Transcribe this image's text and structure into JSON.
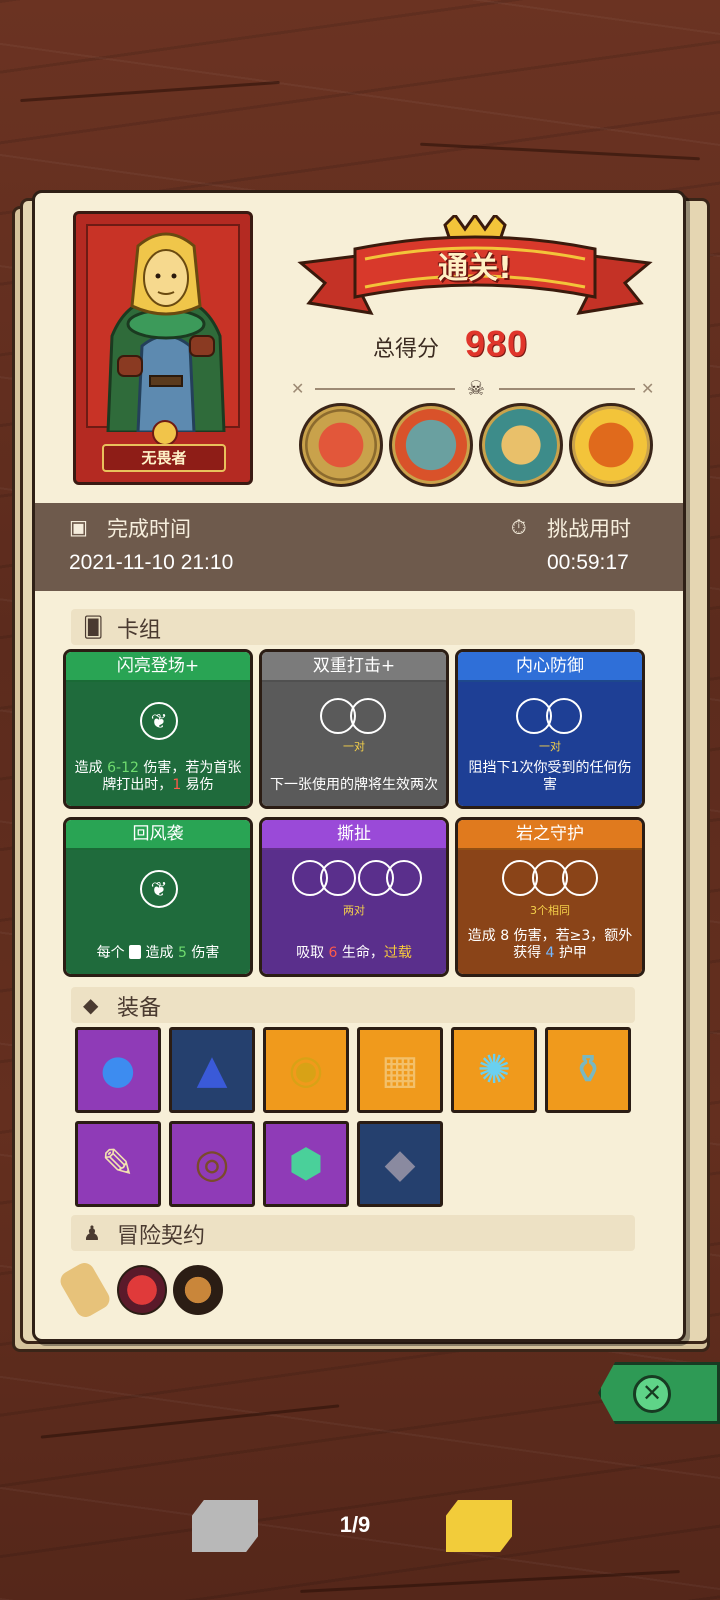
{
  "hero": {
    "name": "无畏者"
  },
  "result": {
    "title": "通关!",
    "score_label": "总得分",
    "score": "980"
  },
  "time": {
    "complete_label": "完成时间",
    "complete_value": "2021-11-10 21:10",
    "challenge_label": "挑战用时",
    "challenge_value": "00:59:17"
  },
  "deck": {
    "label": "卡组",
    "cards": [
      {
        "name": "闪亮登场+",
        "sub": "",
        "desc_parts": [
          "造成 ",
          "6-12",
          " 伤害，若为首张牌打出时，",
          "1",
          " 易伤"
        ]
      },
      {
        "name": "双重打击+",
        "sub": "一对",
        "desc": "下一张使用的牌将生效两次"
      },
      {
        "name": "内心防御",
        "sub": "一对",
        "desc": "阻挡下1次你受到的任何伤害"
      },
      {
        "name": "回风袭",
        "sub": "",
        "desc_parts": [
          "每个 ",
          " 造成 ",
          "5",
          " 伤害"
        ]
      },
      {
        "name": "撕扯",
        "sub": "两对",
        "desc_parts": [
          "吸取 ",
          "6",
          " 生命，",
          "过载"
        ]
      },
      {
        "name": "岩之守护",
        "sub": "3个相同",
        "desc_parts": [
          "造成 ",
          "8",
          " 伤害，若",
          "≥3，额外获得 ",
          "4",
          " 护甲"
        ]
      }
    ]
  },
  "equipment": {
    "label": "装备"
  },
  "contracts": {
    "label": "冒险契约"
  },
  "pager": {
    "text": "1/9"
  },
  "colors": {
    "score": "#e0352b",
    "panel": "#f7efd7",
    "band": "#6e5a4c"
  }
}
